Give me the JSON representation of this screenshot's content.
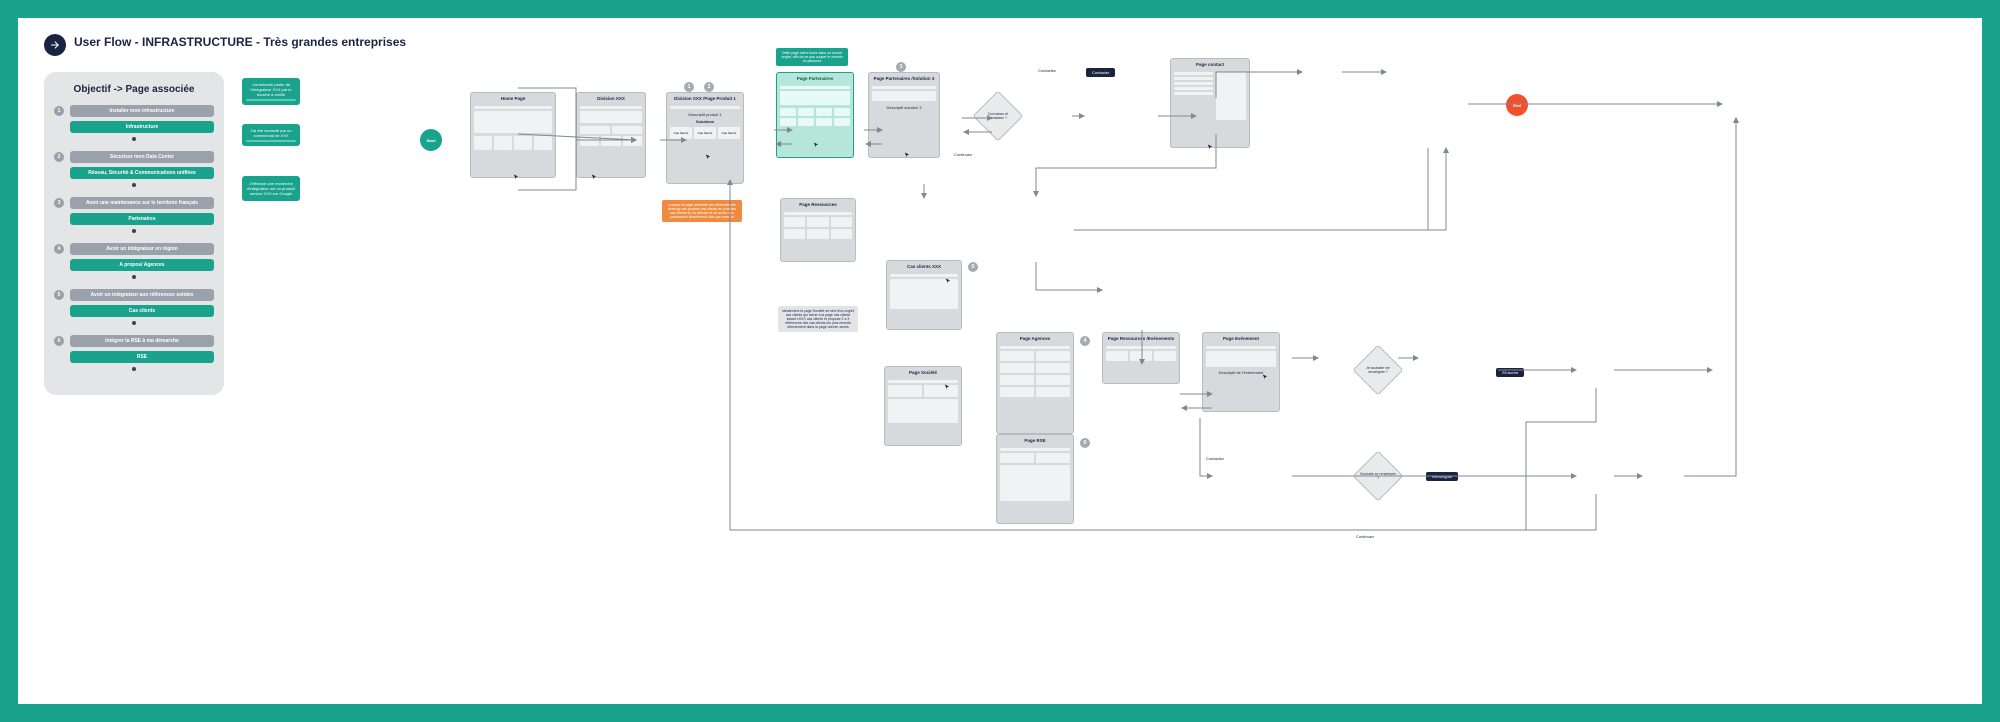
{
  "title": "User Flow - INFRASTRUCTURE - Très grandes entreprises",
  "legend": {
    "heading": "Objectif -> Page associée",
    "groups": [
      {
        "num": "1",
        "obj": "Installer mon infrastructure",
        "page": "Infrastructure"
      },
      {
        "num": "2",
        "obj": "Sécuriser mon Data Center",
        "page": "Réseau, Sécurité & Communications unifiées"
      },
      {
        "num": "3",
        "obj": "Avoir une maintenance sur le territoire français",
        "page": "Partenaires"
      },
      {
        "num": "4",
        "obj": "Avoir un intégrateur en région",
        "page": "A propos/ Agences"
      },
      {
        "num": "5",
        "obj": "Avoir un intégrateur aux références solides",
        "page": "Cas clients"
      },
      {
        "num": "6",
        "obj": "Intégrer la RSE à ma démarche",
        "page": "RSE"
      }
    ]
  },
  "entries": {
    "e1": "J'ai entendu parler de l'intégrateur XXX par le bouche à oreille",
    "e2": "J'ai été contacté par un commercial de XXX",
    "e3": "J'effectue une recherche d'intégrateur sur un produit/ service XXX sur Google"
  },
  "start": "Start",
  "end": "End",
  "pages": {
    "home": "Home Page",
    "division": "Division XXX",
    "produit": {
      "title": "Division XXX /Page Produit 1",
      "desc": "Descriptif produit 1",
      "sol": "Solutions",
      "cas": [
        "Cas clients",
        "Cas clients",
        "Cas clients"
      ]
    },
    "partenaires": {
      "title": "Page Partenaires"
    },
    "partenaires_sol": {
      "title": "Page Partenaires /Solution 3",
      "desc": "Descriptif solution 3"
    },
    "ressources": "Page Ressources",
    "cas_clients": "Cas clients XXX",
    "societe": "Page Société",
    "agences": "Page Agences",
    "ressources_ev": "Page Ressources /Evénements",
    "evenement": {
      "title": "Page Evénement",
      "desc": "Descriptif de l'évènement"
    },
    "rse": "Page RSE",
    "contact": "Page contact"
  },
  "notes": {
    "teal_top": "Cette page doit s'ouvrir dans un nouvel onglet, afin de ne pas couper le chemin du parcours",
    "orange": "Lorsque la page présente ces éléments elle héberge ses propres cas clients en plus des cas clients de sa division et un accès aux partenaires directement cités par marque",
    "grey": "Idéalement la page Société se sert d'un onglet cas clients qui mène à la page cas clients listant ±XXX cas clients et propose 2 a 3 références des cas clients les plus récents directement dans la page donner accès"
  },
  "diamonds": {
    "d1": "Convaincu et contactez ?",
    "d2": "Je souhaite me renseigner ?",
    "d3": "Souhaite se renseigner ?"
  },
  "flowlabels": {
    "contactez": "Contactez",
    "continuez": "Continuez"
  },
  "actions": {
    "contacter": "Contacter",
    "inscrire": "S'inscrire",
    "renseigner": "Renseigner"
  },
  "steps": {
    "s1": "1",
    "s2": "2",
    "s3": "3",
    "s4": "4",
    "s5": "5",
    "s6": "6"
  }
}
